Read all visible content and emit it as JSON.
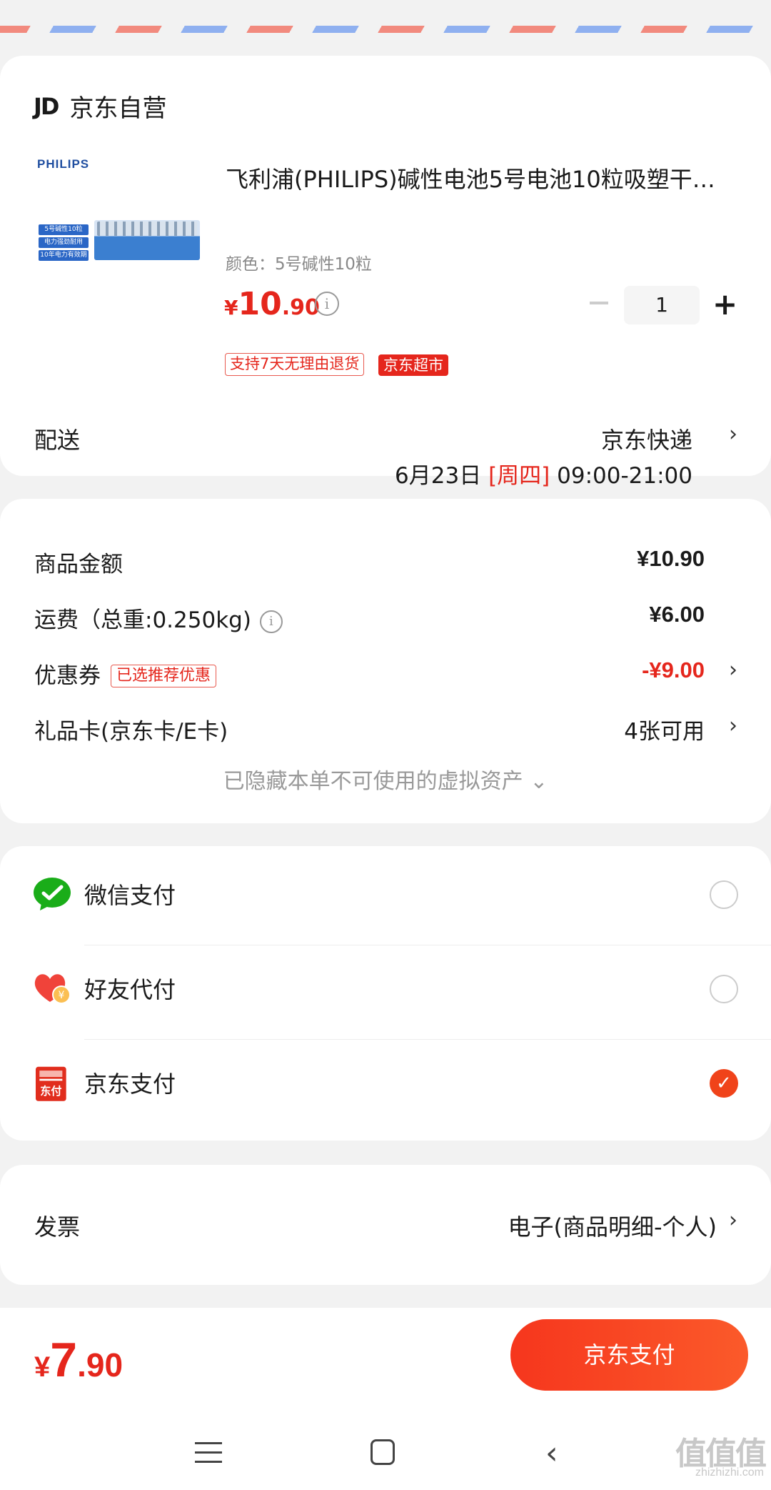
{
  "shop": {
    "logo": "JD",
    "name": "京东自营"
  },
  "product": {
    "brand_logo": "PHILIPS",
    "pack_tags": [
      "5号碱性10粒",
      "电力强劲耐用",
      "10年电力有效期"
    ],
    "title": "飞利浦(PHILIPS)碱性电池5号电池10粒吸塑干…",
    "spec": "颜色：5号碱性10粒",
    "price_yen": "¥",
    "price_int": "10",
    "price_dec": ".90",
    "quantity": "1",
    "badges": {
      "return": "支持7天无理由退货",
      "market": "京东超市"
    }
  },
  "shipping": {
    "label": "配送",
    "method": "京东快递",
    "date": "6月23日",
    "weekday": "[周四]",
    "time": "09:00-21:00"
  },
  "summary": {
    "goods_label": "商品金额",
    "goods_value": "¥10.90",
    "freight_label": "运费（总重:0.250kg)",
    "freight_value": "¥6.00",
    "coupon_label": "优惠券",
    "coupon_tag": "已选推荐优惠",
    "coupon_value": "-¥9.00",
    "giftcard_label": "礼品卡(京东卡/E卡)",
    "giftcard_value": "4张可用",
    "hidden_assets": "已隐藏本单不可使用的虚拟资产 ⌄"
  },
  "payment": {
    "options": [
      {
        "label": "微信支付",
        "icon": "wechat-pay-icon",
        "selected": false
      },
      {
        "label": "好友代付",
        "icon": "friend-pay-icon",
        "selected": false
      },
      {
        "label": "京东支付",
        "icon": "jd-pay-icon",
        "icon_text": "东付",
        "selected": true
      }
    ]
  },
  "invoice": {
    "label": "发票",
    "value": "电子(商品明细-个人)"
  },
  "footer": {
    "total_yen": "¥",
    "total_int": "7",
    "total_dec": ".90",
    "pay_button": "京东支付"
  },
  "watermark": {
    "main": "值值值",
    "sub": "zhizhizhi.com"
  },
  "colors": {
    "accent": "#e5261c",
    "button": "#f6361d",
    "wechat": "#1aad19"
  }
}
